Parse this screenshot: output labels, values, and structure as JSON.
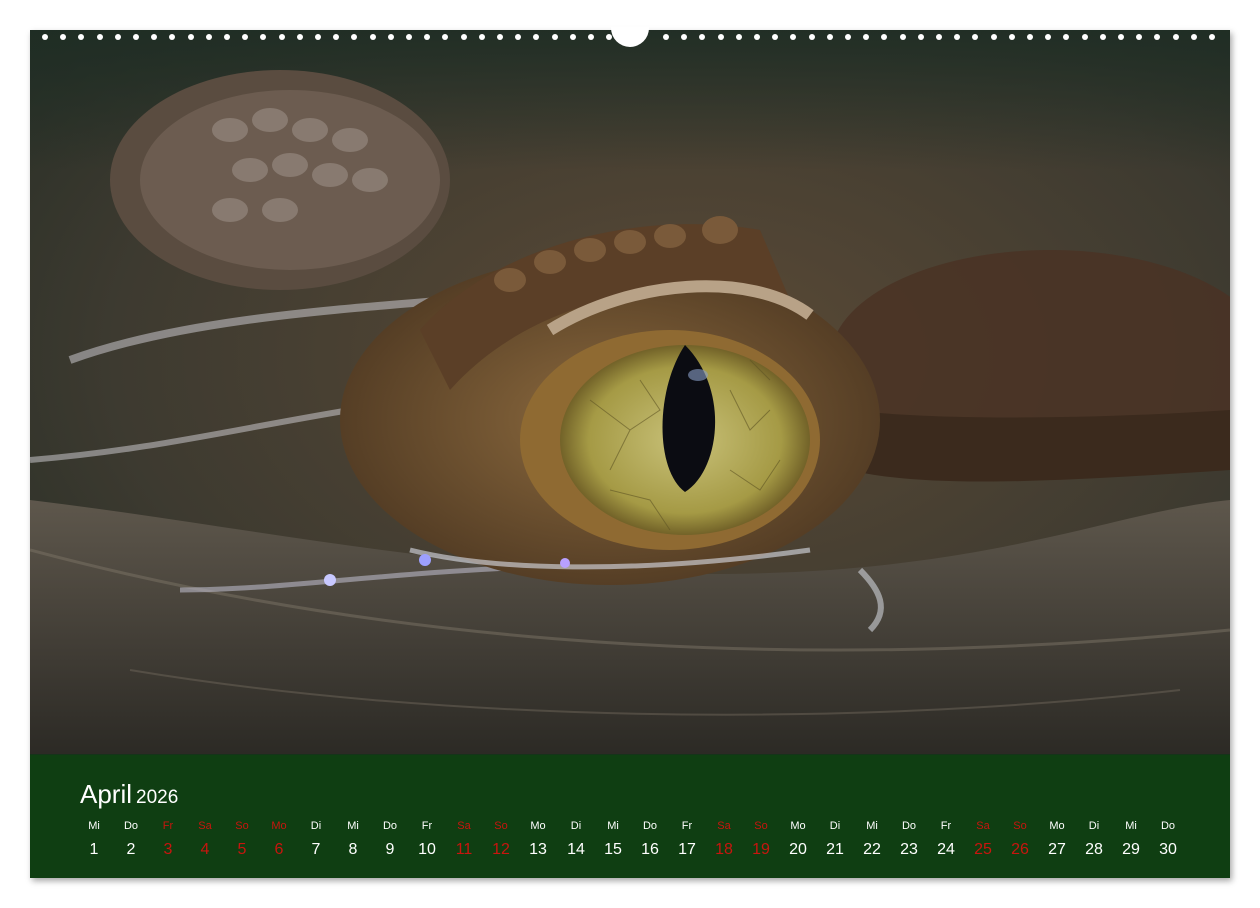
{
  "calendar": {
    "month": "April",
    "year": "2026",
    "weekend_color": "#c8150e",
    "band_color": "#0f3e12",
    "photo_subject": "crocodile-eye-close-up",
    "days": [
      {
        "dow": "Mi",
        "num": "1",
        "weekend": false
      },
      {
        "dow": "Do",
        "num": "2",
        "weekend": false
      },
      {
        "dow": "Fr",
        "num": "3",
        "weekend": true
      },
      {
        "dow": "Sa",
        "num": "4",
        "weekend": true
      },
      {
        "dow": "So",
        "num": "5",
        "weekend": true
      },
      {
        "dow": "Mo",
        "num": "6",
        "weekend": true
      },
      {
        "dow": "Di",
        "num": "7",
        "weekend": false
      },
      {
        "dow": "Mi",
        "num": "8",
        "weekend": false
      },
      {
        "dow": "Do",
        "num": "9",
        "weekend": false
      },
      {
        "dow": "Fr",
        "num": "10",
        "weekend": false
      },
      {
        "dow": "Sa",
        "num": "11",
        "weekend": true
      },
      {
        "dow": "So",
        "num": "12",
        "weekend": true
      },
      {
        "dow": "Mo",
        "num": "13",
        "weekend": false
      },
      {
        "dow": "Di",
        "num": "14",
        "weekend": false
      },
      {
        "dow": "Mi",
        "num": "15",
        "weekend": false
      },
      {
        "dow": "Do",
        "num": "16",
        "weekend": false
      },
      {
        "dow": "Fr",
        "num": "17",
        "weekend": false
      },
      {
        "dow": "Sa",
        "num": "18",
        "weekend": true
      },
      {
        "dow": "So",
        "num": "19",
        "weekend": true
      },
      {
        "dow": "Mo",
        "num": "20",
        "weekend": false
      },
      {
        "dow": "Di",
        "num": "21",
        "weekend": false
      },
      {
        "dow": "Mi",
        "num": "22",
        "weekend": false
      },
      {
        "dow": "Do",
        "num": "23",
        "weekend": false
      },
      {
        "dow": "Fr",
        "num": "24",
        "weekend": false
      },
      {
        "dow": "Sa",
        "num": "25",
        "weekend": true
      },
      {
        "dow": "So",
        "num": "26",
        "weekend": true
      },
      {
        "dow": "Mo",
        "num": "27",
        "weekend": false
      },
      {
        "dow": "Di",
        "num": "28",
        "weekend": false
      },
      {
        "dow": "Mi",
        "num": "29",
        "weekend": false
      },
      {
        "dow": "Do",
        "num": "30",
        "weekend": false
      }
    ]
  }
}
